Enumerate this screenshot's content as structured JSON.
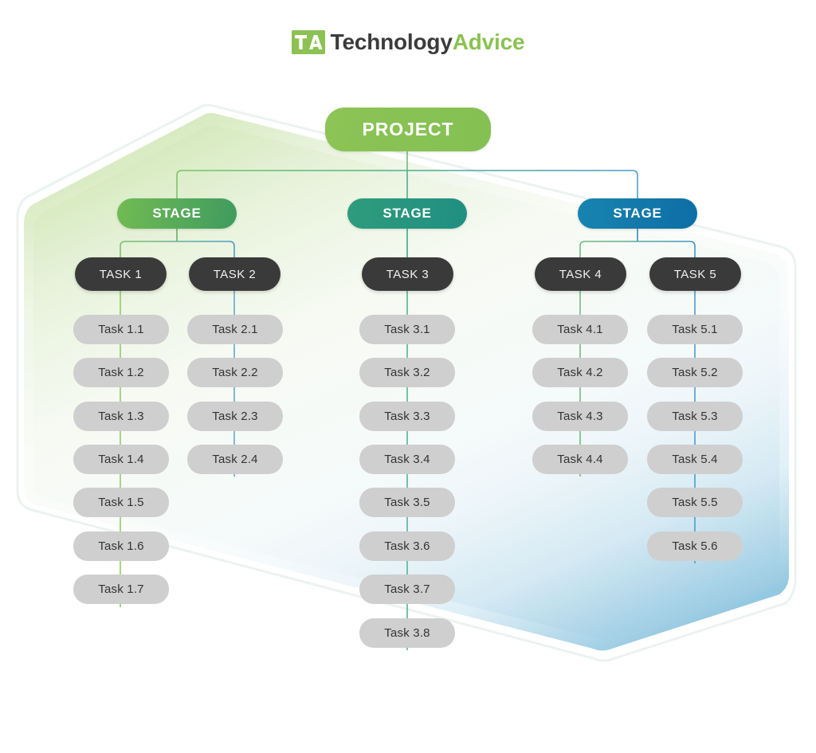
{
  "logo": {
    "mark_text": "TA",
    "mark_icon": "ta-logo-icon",
    "name_part1": "Technology",
    "name_part2": "Advice",
    "color_green": "#8cc153",
    "color_dark": "#3b3b3b"
  },
  "colors": {
    "project": "#8cc455",
    "stage_1": "#72bb53",
    "stage_2": "#2e9c7c",
    "stage_3": "#1884b0",
    "task": "#3a3a3a",
    "subtask": "#cfcfcf",
    "wire_green": "#7ec267",
    "wire_teal": "#49a889",
    "wire_blue": "#4a9ec8",
    "hex_green": "#cfe7b4",
    "hex_blue": "#8fc6e0"
  },
  "chart_data": {
    "type": "diagram",
    "title": "Project Work Breakdown Structure",
    "levels": [
      "Project",
      "Stage",
      "Task",
      "Subtask"
    ],
    "root": "PROJECT",
    "stages": 3,
    "tasks": 5,
    "subtask_counts": [
      7,
      4,
      8,
      4,
      6
    ]
  },
  "project": {
    "label": "PROJECT"
  },
  "stages": [
    {
      "label": "STAGE",
      "id": "stage-1"
    },
    {
      "label": "STAGE",
      "id": "stage-2"
    },
    {
      "label": "STAGE",
      "id": "stage-3"
    }
  ],
  "tasks": [
    {
      "label": "TASK 1"
    },
    {
      "label": "TASK 2"
    },
    {
      "label": "TASK 3"
    },
    {
      "label": "TASK 4"
    },
    {
      "label": "TASK 5"
    }
  ],
  "columns": [
    {
      "task": "TASK 1",
      "subtasks": [
        "Task 1.1",
        "Task 1.2",
        "Task 1.3",
        "Task 1.4",
        "Task 1.5",
        "Task 1.6",
        "Task 1.7"
      ]
    },
    {
      "task": "TASK 2",
      "subtasks": [
        "Task 2.1",
        "Task 2.2",
        "Task 2.3",
        "Task 2.4"
      ]
    },
    {
      "task": "TASK 3",
      "subtasks": [
        "Task 3.1",
        "Task 3.2",
        "Task 3.3",
        "Task 3.4",
        "Task 3.5",
        "Task 3.6",
        "Task 3.7",
        "Task 3.8"
      ]
    },
    {
      "task": "TASK 4",
      "subtasks": [
        "Task 4.1",
        "Task 4.2",
        "Task 4.3",
        "Task 4.4"
      ]
    },
    {
      "task": "TASK 5",
      "subtasks": [
        "Task 5.1",
        "Task 5.2",
        "Task 5.3",
        "Task 5.4",
        "Task 5.5",
        "Task 5.6"
      ]
    }
  ]
}
